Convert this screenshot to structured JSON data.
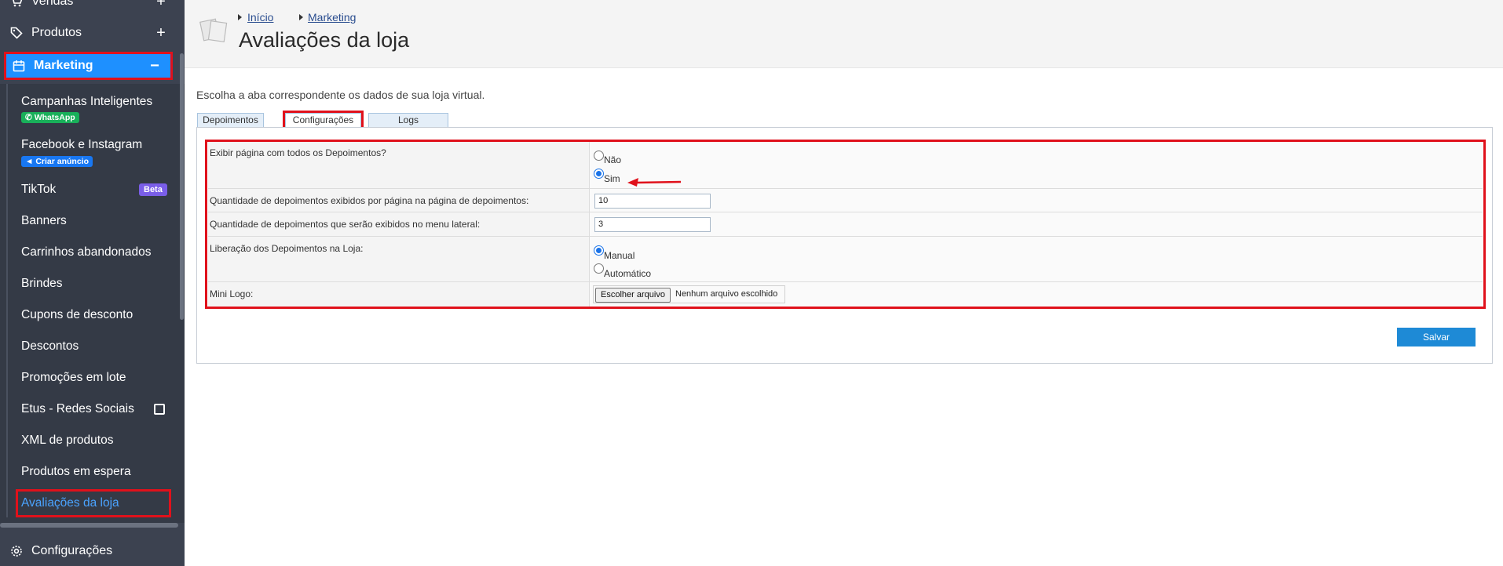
{
  "sidebar": {
    "items": {
      "vendas": "Vendas",
      "produtos": "Produtos",
      "marketing": "Marketing",
      "configuracoes": "Configurações"
    },
    "expand_symbol": "+",
    "collapse_symbol": "−",
    "marketing_sub": {
      "campanhas": "Campanhas Inteligentes",
      "campanhas_badge": "WhatsApp",
      "facebook": "Facebook e Instagram",
      "facebook_badge": "Criar anúncio",
      "tiktok": "TikTok",
      "tiktok_badge": "Beta",
      "banners": "Banners",
      "carrinhos": "Carrinhos abandonados",
      "brindes": "Brindes",
      "cupons": "Cupons de desconto",
      "descontos": "Descontos",
      "promocoes": "Promoções em lote",
      "etus": "Etus - Redes Sociais",
      "xml": "XML de produtos",
      "espera": "Produtos em espera",
      "avaliacoes": "Avaliações da loja"
    }
  },
  "header": {
    "breadcrumb": [
      "Início",
      "Marketing"
    ],
    "title": "Avaliações da loja"
  },
  "main": {
    "description": "Escolha a aba correspondente os dados de sua loja virtual.",
    "tabs": [
      "Depoimentos",
      "Configurações",
      "Logs"
    ],
    "active_tab": "Configurações",
    "form": {
      "exibir_label": "Exibir página com todos os Depoimentos?",
      "exibir_options": [
        "Não",
        "Sim"
      ],
      "exibir_selected": "Sim",
      "qtd_pagina_label": "Quantidade de depoimentos exibidos por página na página de depoimentos:",
      "qtd_pagina_value": "10",
      "qtd_menu_label": "Quantidade de depoimentos que serão exibidos no menu lateral:",
      "qtd_menu_value": "3",
      "liberacao_label": "Liberação dos Depoimentos na Loja:",
      "liberacao_options": [
        "Manual",
        "Automático"
      ],
      "liberacao_selected": "Manual",
      "mini_logo_label": "Mini Logo:",
      "file_button": "Escolher arquivo",
      "file_status": "Nenhum arquivo escolhido"
    },
    "save_label": "Salvar"
  },
  "colors": {
    "sidebar_bg": "#3c4250",
    "accent": "#1e90ff",
    "highlight": "#e0111b",
    "save": "#1e8ad6"
  }
}
